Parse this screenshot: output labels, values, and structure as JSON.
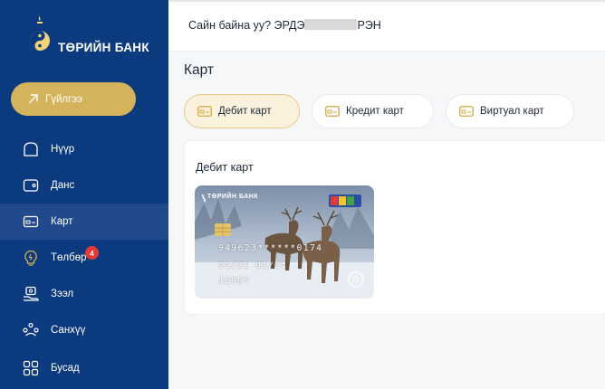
{
  "brand": {
    "name": "ТӨРИЙН БАНК",
    "color": "#0c3a7e",
    "accent": "#d4b35c"
  },
  "sidebar": {
    "transfer_label": "Гүйлгээ",
    "items": [
      {
        "label": "Нүүр",
        "icon": "home-icon"
      },
      {
        "label": "Данс",
        "icon": "wallet-icon"
      },
      {
        "label": "Карт",
        "icon": "card-icon",
        "active": true
      },
      {
        "label": "Төлбөр",
        "icon": "bulb-icon",
        "badge": "4"
      },
      {
        "label": "Зээл",
        "icon": "loan-icon"
      },
      {
        "label": "Санхүү",
        "icon": "finance-icon"
      },
      {
        "label": "Бусад",
        "icon": "grid-icon"
      }
    ]
  },
  "header": {
    "greeting_prefix": "Сайн байна уу? ЭРДЭ",
    "greeting_suffix": "РЭН"
  },
  "page": {
    "title": "Карт",
    "tabs": [
      {
        "label": "Дебит карт",
        "active": true
      },
      {
        "label": "Кредит карт"
      },
      {
        "label": "Виртуал карт"
      }
    ],
    "section_title": "Дебит карт"
  },
  "card": {
    "bank": "ТӨРИЙН БАНК",
    "number": "949623******0174",
    "expiry": "01/21  01/24",
    "holder": "JERRY"
  }
}
